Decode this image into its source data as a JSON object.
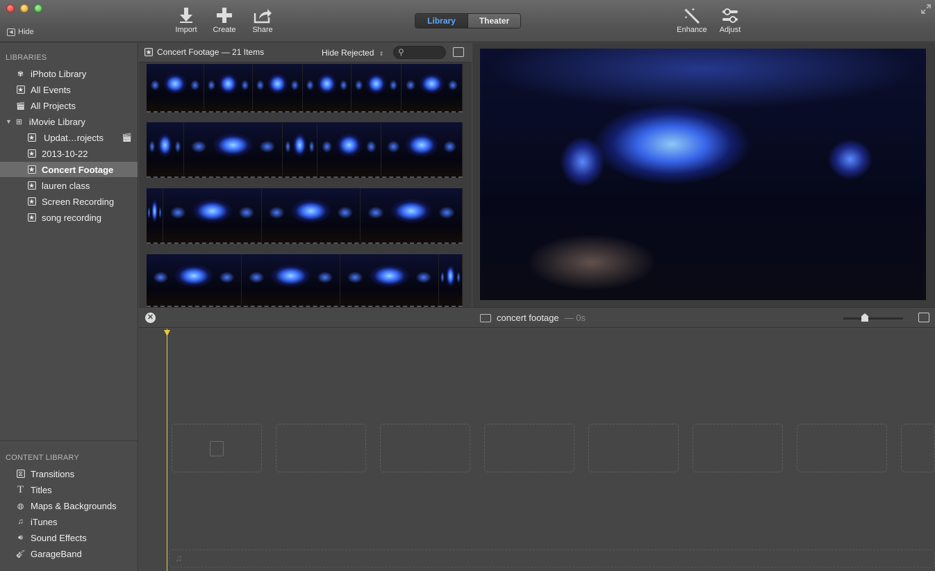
{
  "toolbar": {
    "hide_label": "Hide",
    "import_label": "Import",
    "create_label": "Create",
    "share_label": "Share",
    "library_tab": "Library",
    "theater_tab": "Theater",
    "enhance_label": "Enhance",
    "adjust_label": "Adjust"
  },
  "sidebar": {
    "libraries_header": "LIBRARIES",
    "items": [
      {
        "label": "iPhoto Library",
        "icon": "iphoto-icon"
      },
      {
        "label": "All Events",
        "icon": "star-icon"
      },
      {
        "label": "All Projects",
        "icon": "clapper-icon"
      },
      {
        "label": "iMovie Library",
        "icon": "grid-icon"
      },
      {
        "label": "Updat…rojects",
        "icon": "star-icon"
      },
      {
        "label": "2013-10-22",
        "icon": "star-icon"
      },
      {
        "label": "Concert Footage",
        "icon": "star-icon",
        "selected": true
      },
      {
        "label": "lauren class",
        "icon": "star-icon"
      },
      {
        "label": "Screen Recording",
        "icon": "star-icon"
      },
      {
        "label": "song recording",
        "icon": "star-icon"
      }
    ],
    "content_header": "CONTENT LIBRARY",
    "content_items": [
      {
        "label": "Transitions",
        "icon": "transitions-icon"
      },
      {
        "label": "Titles",
        "icon": "titles-icon"
      },
      {
        "label": "Maps & Backgrounds",
        "icon": "globe-icon"
      },
      {
        "label": "iTunes",
        "icon": "music-note-icon"
      },
      {
        "label": "Sound Effects",
        "icon": "speaker-icon"
      },
      {
        "label": "GarageBand",
        "icon": "guitar-icon"
      }
    ]
  },
  "browser": {
    "title": "Concert Footage — 21 Items",
    "filter_label": "Hide Rejected"
  },
  "timeline": {
    "title": "concert footage",
    "duration": "— 0s"
  },
  "colors": {
    "accent": "#5aa8ff",
    "playhead": "#e8c93a",
    "selection": "#6b6b6b"
  }
}
